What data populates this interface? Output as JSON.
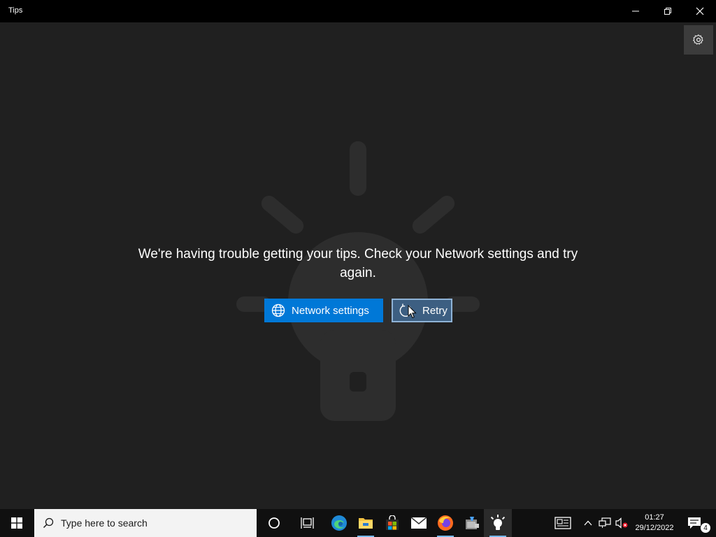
{
  "window": {
    "title": "Tips",
    "minimize_icon": "minimize-icon",
    "restore_icon": "restore-icon",
    "close_icon": "close-icon"
  },
  "app": {
    "settings_icon": "gear-icon",
    "background_icon": "lightbulb-icon",
    "message": "We're having trouble getting your tips. Check your Network settings and try again.",
    "network_button": {
      "label": "Network settings",
      "icon": "globe-icon"
    },
    "retry_button": {
      "label": "Retry",
      "icon": "refresh-icon"
    },
    "accent_color": "#0078d7"
  },
  "taskbar": {
    "search_placeholder": "Type here to search",
    "pinned_apps": [
      "Cortana",
      "Task View",
      "Microsoft Edge",
      "File Explorer",
      "Microsoft Store",
      "Mail",
      "Firefox",
      "Setup",
      "Tips"
    ],
    "clock": {
      "time": "01:27",
      "date": "29/12/2022"
    },
    "notification_count": "4"
  }
}
